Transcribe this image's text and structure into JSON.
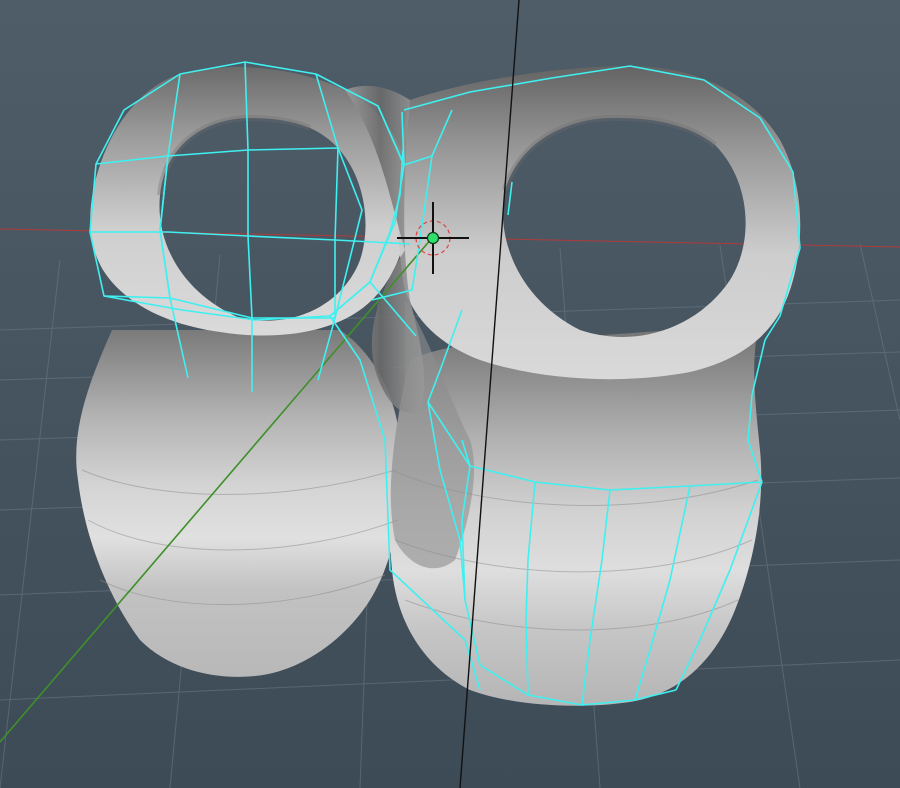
{
  "viewport": {
    "panel": "3d-viewport-perspective",
    "view": "perspective",
    "background_color": "#4a5865"
  },
  "scene": {
    "object": "twin-ring-tube-mesh",
    "shading": "flat-shaded-gray",
    "selection_highlight": "edge-loops",
    "colors": {
      "mesh_light": "#d6d6d6",
      "mesh_mid": "#a9a9a9",
      "mesh_dark": "#5f5f5f",
      "selected_edges": "#3ff0f0",
      "grid_lines": "#6f7c87",
      "axis_x": "#b03a3a",
      "axis_y_vertical": "#111111",
      "axis_z": "#3f8f2a",
      "pivot_center": "#2ee06a",
      "pivot_ring": "#e04040"
    }
  },
  "manipulator": {
    "type": "move-pivot",
    "icon": "crosshair-pivot-icon"
  }
}
